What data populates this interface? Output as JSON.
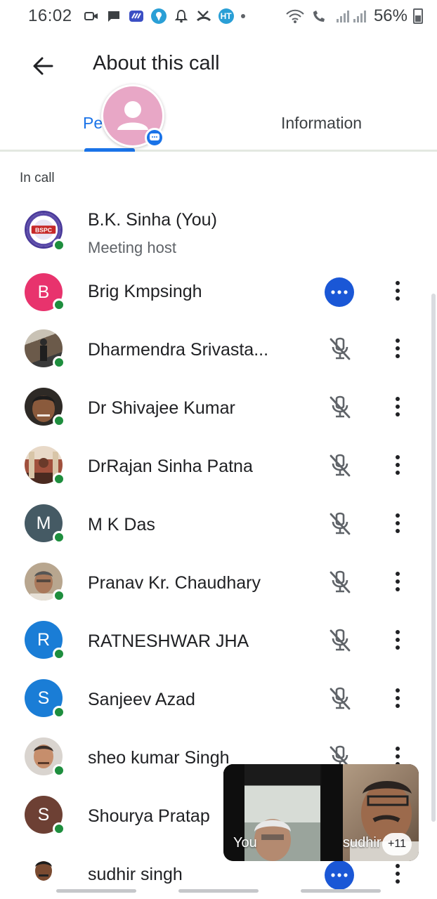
{
  "status_bar": {
    "time": "16:02",
    "battery": "56%",
    "notification_icons": [
      "video-icon",
      "message-icon",
      "app-icon",
      "location-icon",
      "app-icon",
      "missed-call-icon",
      "ht-icon"
    ]
  },
  "header": {
    "title": "About this call"
  },
  "tabs": [
    {
      "label": "Pe",
      "active": true
    },
    {
      "label": "Information",
      "active": false
    }
  ],
  "section_label": "In call",
  "participants": [
    {
      "name": "B.K. Sinha (You)",
      "subtitle": "Meeting host",
      "avatar_type": "logo",
      "avatar_text": "BSPC",
      "avatar_color": "#ffffff",
      "action": "none"
    },
    {
      "name": "Brig Kmpsingh",
      "avatar_type": "letter",
      "avatar_text": "B",
      "avatar_color": "#e8336d",
      "action": "more"
    },
    {
      "name": "Dharmendra Srivasta...",
      "avatar_type": "photo",
      "avatar_text": "",
      "avatar_color": "#6b5a4a",
      "action": "muted"
    },
    {
      "name": "Dr Shivajee Kumar",
      "avatar_type": "photo",
      "avatar_text": "",
      "avatar_color": "#4a3b2e",
      "action": "muted"
    },
    {
      "name": "DrRajan Sinha Patna",
      "avatar_type": "photo",
      "avatar_text": "",
      "avatar_color": "#8a4b3a",
      "action": "muted"
    },
    {
      "name": "M K Das",
      "avatar_type": "letter",
      "avatar_text": "M",
      "avatar_color": "#455a64",
      "action": "muted"
    },
    {
      "name": "Pranav Kr. Chaudhary",
      "avatar_type": "photo",
      "avatar_text": "",
      "avatar_color": "#9c8a72",
      "action": "muted"
    },
    {
      "name": "RATNESHWAR JHA",
      "avatar_type": "letter",
      "avatar_text": "R",
      "avatar_color": "#1a7dd6",
      "action": "muted"
    },
    {
      "name": "Sanjeev Azad",
      "avatar_type": "letter",
      "avatar_text": "S",
      "avatar_color": "#1a7dd6",
      "action": "muted"
    },
    {
      "name": "sheo kumar Singh",
      "avatar_type": "photo",
      "avatar_text": "",
      "avatar_color": "#c9b2a0",
      "action": "muted"
    },
    {
      "name": "Shourya Pratap",
      "avatar_type": "letter",
      "avatar_text": "S",
      "avatar_color": "#6d4034",
      "action": "muted"
    },
    {
      "name": "sudhir singh",
      "avatar_type": "photo",
      "avatar_text": "",
      "avatar_color": "#5a4636",
      "action": "more"
    }
  ],
  "pip": {
    "you_label": "You",
    "other_label": "sudhir",
    "more_count": "+11"
  }
}
